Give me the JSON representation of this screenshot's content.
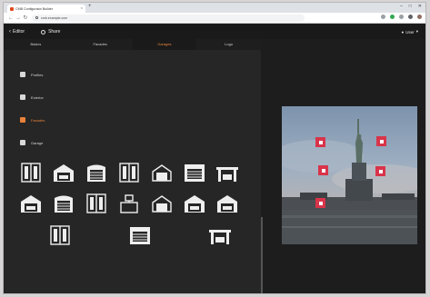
{
  "browser": {
    "tab_title": "CMB Configurator Builder",
    "tab_close": "×",
    "new_tab": "+",
    "url": "cmb.example.com",
    "window_controls": [
      "–",
      "□",
      "✕"
    ]
  },
  "appbar": {
    "back_label": "Editor",
    "share_label": "Share",
    "user_label": "User"
  },
  "categories": [
    {
      "label": "Basics",
      "active": false
    },
    {
      "label": "Facades",
      "active": false
    },
    {
      "label": "Garages",
      "active": true
    },
    {
      "label": "Logo",
      "active": false
    }
  ],
  "options": [
    {
      "label": "Profiles",
      "active": false
    },
    {
      "label": "Exterior",
      "active": false
    },
    {
      "label": "Facades",
      "active": true
    },
    {
      "label": "Garage",
      "active": false
    }
  ],
  "icon_rows": [
    [
      "double-door-icon",
      "garage-car-icon",
      "garage-shutter-icon",
      "double-door-icon",
      "garage-house-icon",
      "garage-gate-icon",
      "carport-icon"
    ],
    [
      "garage-car-icon",
      "garage-shutter-icon",
      "double-door-icon",
      "robot-icon",
      "garage-house-icon",
      "garage-car-icon",
      "garage-car-icon"
    ],
    [
      "double-door-icon",
      "garage-gate-icon",
      "carport-icon"
    ]
  ],
  "colors": {
    "accent": "#e8823a",
    "marker": "#d8344a"
  }
}
